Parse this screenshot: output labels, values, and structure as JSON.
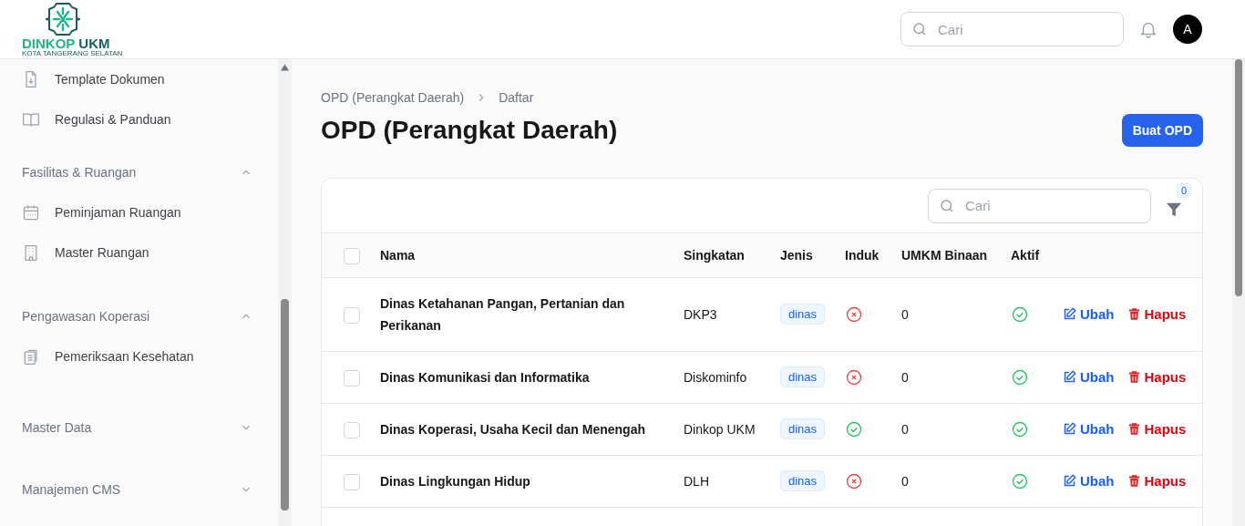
{
  "logo": {
    "name_part_1": "DINKOP",
    "name_part_2": "UKM",
    "subtitle": "KOTA TANGERANG SELATAN"
  },
  "header": {
    "search_placeholder": "Cari",
    "avatar": "A"
  },
  "sidebar": {
    "sections": [
      {
        "items": [
          {
            "label": "Template Dokumen"
          },
          {
            "label": "Regulasi & Panduan"
          }
        ]
      },
      {
        "title": "Fasilitas & Ruangan",
        "expanded": true,
        "items": [
          {
            "label": "Peminjaman Ruangan"
          },
          {
            "label": "Master Ruangan"
          }
        ]
      },
      {
        "title": "Pengawasan Koperasi",
        "expanded": true,
        "items": [
          {
            "label": "Pemeriksaan Kesehatan"
          }
        ]
      },
      {
        "title": "Master Data",
        "expanded": false
      },
      {
        "title": "Manajemen CMS",
        "expanded": false
      }
    ]
  },
  "breadcrumb": [
    "OPD (Perangkat Daerah)",
    "Daftar"
  ],
  "page_title": "OPD (Perangkat Daerah)",
  "create_button": "Buat OPD",
  "table": {
    "search_placeholder": "Cari",
    "filter_count": "0",
    "select_all_checked": false,
    "columns": [
      "Nama",
      "Singkatan",
      "Jenis",
      "Induk",
      "UMKM Binaan",
      "Aktif"
    ],
    "rows": [
      {
        "nama": "Dinas Ketahanan Pangan, Pertanian dan Perikanan",
        "singkatan": "DKP3",
        "jenis": "dinas",
        "induk": false,
        "umkm_binaan": "0",
        "aktif": true,
        "checked": false,
        "edit": "Ubah",
        "delete": "Hapus"
      },
      {
        "nama": "Dinas Komunikasi dan Informatika",
        "singkatan": "Diskominfo",
        "jenis": "dinas",
        "induk": false,
        "umkm_binaan": "0",
        "aktif": true,
        "checked": false,
        "edit": "Ubah",
        "delete": "Hapus"
      },
      {
        "nama": "Dinas Koperasi, Usaha Kecil dan Menengah",
        "singkatan": "Dinkop UKM",
        "jenis": "dinas",
        "induk": true,
        "umkm_binaan": "0",
        "aktif": true,
        "checked": false,
        "edit": "Ubah",
        "delete": "Hapus"
      },
      {
        "nama": "Dinas Lingkungan Hidup",
        "singkatan": "DLH",
        "jenis": "dinas",
        "induk": false,
        "umkm_binaan": "0",
        "aktif": true,
        "checked": false,
        "edit": "Ubah",
        "delete": "Hapus"
      }
    ]
  }
}
